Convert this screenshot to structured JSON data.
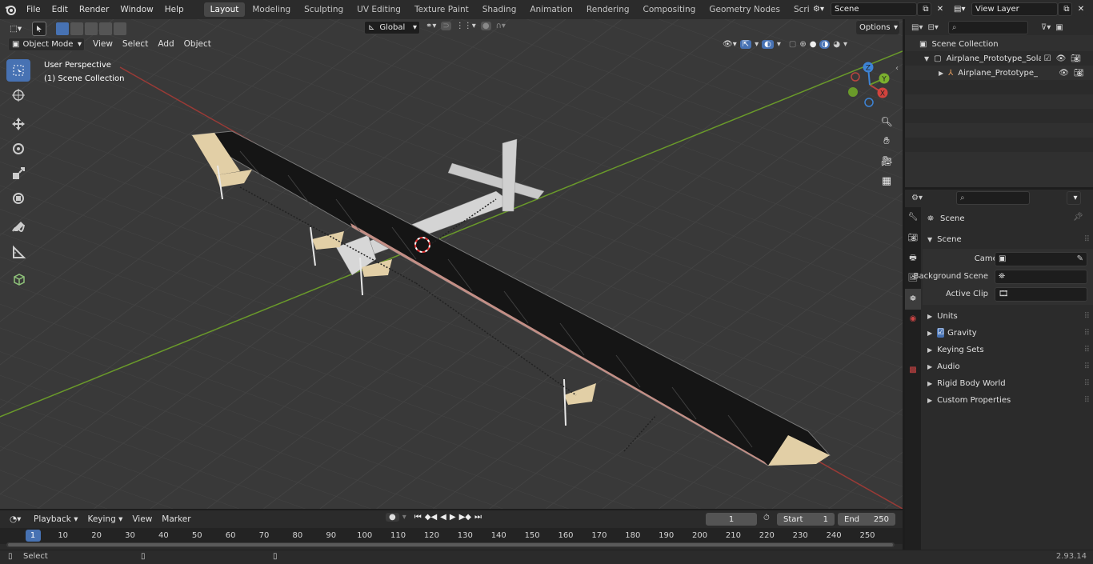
{
  "top_menu": [
    "File",
    "Edit",
    "Render",
    "Window",
    "Help"
  ],
  "workspace_tabs": [
    "Layout",
    "Modeling",
    "Sculpting",
    "UV Editing",
    "Texture Paint",
    "Shading",
    "Animation",
    "Rendering",
    "Compositing",
    "Geometry Nodes",
    "Scripting"
  ],
  "active_workspace": "Layout",
  "scene_selector": "Scene",
  "view_layer_selector": "View Layer",
  "viewport": {
    "mode": "Object Mode",
    "menus": [
      "View",
      "Select",
      "Add",
      "Object"
    ],
    "orientation": "Global",
    "options_label": "Options",
    "perspective_label": "User Perspective",
    "collection_label": "(1) Scene Collection",
    "gizmo_axes": {
      "x": "X",
      "y": "Y",
      "z": "Z"
    }
  },
  "outliner": {
    "root": "Scene Collection",
    "item1": "Airplane_Prototype_Solar_Imp",
    "item2": "Airplane_Prototype_Solar"
  },
  "properties": {
    "header": "Scene",
    "section": "Scene",
    "camera_label": "Camera",
    "background_scene_label": "Background Scene",
    "active_clip_label": "Active Clip",
    "panels": [
      "Units",
      "Gravity",
      "Keying Sets",
      "Audio",
      "Rigid Body World",
      "Custom Properties"
    ],
    "gravity_checked": true
  },
  "timeline": {
    "menus": [
      "Playback",
      "Keying",
      "View",
      "Marker"
    ],
    "current_frame": "1",
    "start_label": "Start",
    "start_value": "1",
    "end_label": "End",
    "end_value": "250",
    "ticks": [
      "1",
      "10",
      "20",
      "30",
      "40",
      "50",
      "60",
      "70",
      "80",
      "90",
      "100",
      "110",
      "120",
      "130",
      "140",
      "150",
      "160",
      "170",
      "180",
      "190",
      "200",
      "210",
      "220",
      "230",
      "240",
      "250"
    ]
  },
  "status": {
    "left": "Select",
    "version": "2.93.14"
  },
  "colors": {
    "accent": "#4772b3",
    "x_axis": "#b8453f",
    "y_axis": "#6a9a2a",
    "z_axis": "#3d84d6"
  }
}
